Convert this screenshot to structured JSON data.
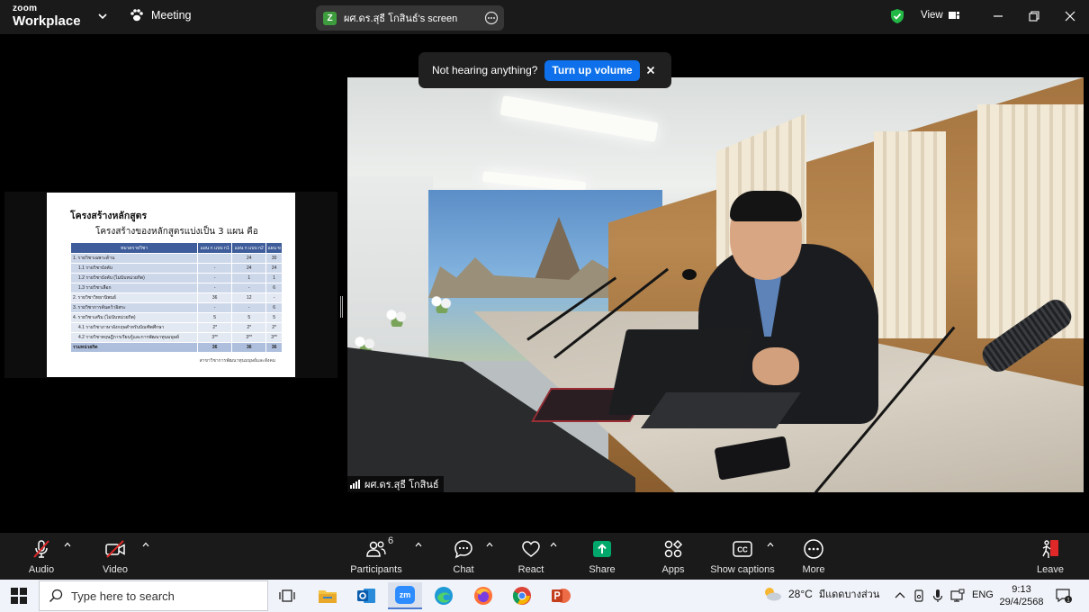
{
  "app": {
    "logo_line1": "zoom",
    "logo_line2": "Workplace",
    "meeting_label": "Meeting",
    "shared_screen_badge": "Z",
    "shared_screen_title": "ผศ.ดร.สุธี โกสินธ์'s screen",
    "view_label": "View"
  },
  "notification": {
    "text": "Not hearing anything?",
    "button": "Turn up volume"
  },
  "slide": {
    "title": "โครงสร้างหลักสูตร",
    "subtitle": "โครงสร้างของหลักสูตรแบ่งเป็น  3 แผน คือ",
    "columns": [
      "หมวดรายวิชา",
      "แผน ก แบบ ก1",
      "แผน ก แบบ ก2",
      "แผน ข"
    ],
    "rows": [
      {
        "label": "1. รายวิชาเฉพาะด้าน",
        "c1": "",
        "c2": "24",
        "c3": "30"
      },
      {
        "label": "1.1 รายวิชาบังคับ",
        "c1": "-",
        "c2": "24",
        "c3": "24"
      },
      {
        "label": "1.2 รายวิชาบังคับ (ไม่นับหน่วยกิต)",
        "c1": "-",
        "c2": "1",
        "c3": "1"
      },
      {
        "label": "1.3 รายวิชาเลือก",
        "c1": "-",
        "c2": "-",
        "c3": "6"
      },
      {
        "label": "2. รายวิชาวิทยานิพนธ์",
        "c1": "36",
        "c2": "12",
        "c3": "-"
      },
      {
        "label": "3. รายวิชาการค้นคว้าอิสระ",
        "c1": "-",
        "c2": "-",
        "c3": "6"
      },
      {
        "label": "4. รายวิชาเสริม (ไม่นับหน่วยกิต)",
        "c1": "5",
        "c2": "5",
        "c3": "5"
      },
      {
        "label": "4.1 รายวิชาภาษาอังกฤษสำหรับบัณฑิตศึกษา",
        "c1": "2*",
        "c2": "2*",
        "c3": "2*"
      },
      {
        "label": "4.2 รายวิชาทฤษฎีการเรียนรู้และการพัฒนาทุนมนุษย์",
        "c1": "3**",
        "c2": "3**",
        "c3": "3**"
      }
    ],
    "total": {
      "label": "รวมหน่วยกิต",
      "c1": "36",
      "c2": "36",
      "c3": "36"
    },
    "caption": "สาขาวิชาการพัฒนาทุนมนุษย์และสังคม"
  },
  "video": {
    "participant_name": "ผศ.ดร.สุธี โกสินธ์"
  },
  "toolbar": {
    "audio": "Audio",
    "video": "Video",
    "participants": "Participants",
    "participants_count": "6",
    "chat": "Chat",
    "react": "React",
    "share": "Share",
    "apps": "Apps",
    "captions": "Show captions",
    "more": "More",
    "leave": "Leave"
  },
  "taskbar": {
    "search_placeholder": "Type here to search",
    "zoom_app": "zm",
    "temperature": "28°C",
    "weather_text": "มีแดดบางส่วน",
    "language": "ENG",
    "time": "9:13",
    "date": "29/4/2568"
  },
  "colors": {
    "zoom_blue": "#0e71eb",
    "share_green": "#00a86b",
    "leave_red": "#e02828",
    "mute_red": "#e02828",
    "secure_green": "#23b845"
  }
}
